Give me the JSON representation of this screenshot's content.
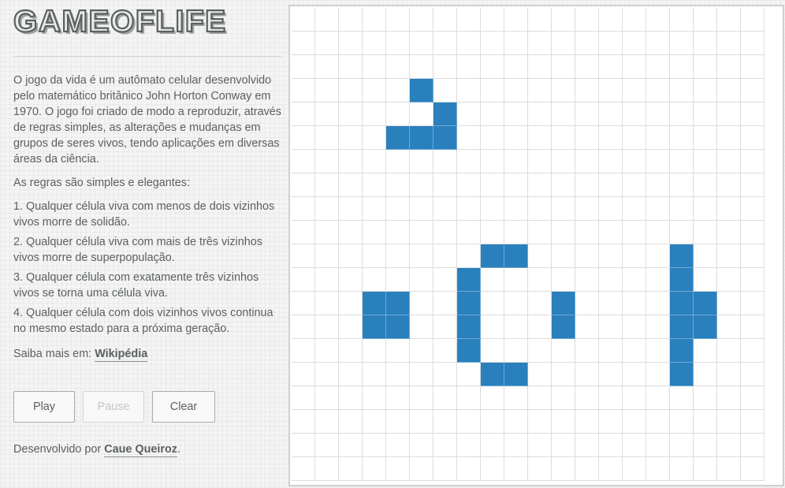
{
  "title": "GAMEOFLIFE",
  "intro": "O jogo da vida é um autômato celular desenvolvido pelo matemático britânico John Horton Conway em 1970. O jogo foi criado de modo a reproduzir, através de regras simples, as alterações e mudanças em grupos de seres vivos, tendo aplicações em diversas áreas da ciência.",
  "rules_heading": "As regras são simples e elegantes:",
  "rules": [
    "1. Qualquer célula viva com menos de dois vizinhos vivos morre de solidão.",
    "2. Qualquer célula viva com mais de três vizinhos vivos morre de superpopulação.",
    "3. Qualquer célula com exatamente três vizinhos vivos se torna uma célula viva.",
    "4. Qualquer célula com dois vizinhos vivos continua no mesmo estado para a próxima geração."
  ],
  "learn_more": {
    "prefix": "Saiba mais em:",
    "link": "Wikipédia"
  },
  "buttons": {
    "play": "Play",
    "pause": "Pause",
    "clear": "Clear",
    "pause_disabled": true
  },
  "footer": {
    "prefix": "Desenvolvido por",
    "author": "Caue Queiroz",
    "suffix": "."
  },
  "colors": {
    "alive": "#2a7fbd",
    "grid_line": "#dcdcdc",
    "text": "#5b6061"
  },
  "board": {
    "rows": 20,
    "cols": 20,
    "alive": [
      [
        3,
        5
      ],
      [
        4,
        6
      ],
      [
        5,
        4
      ],
      [
        5,
        5
      ],
      [
        5,
        6
      ],
      [
        10,
        8
      ],
      [
        10,
        9
      ],
      [
        11,
        7
      ],
      [
        12,
        7
      ],
      [
        13,
        7
      ],
      [
        14,
        7
      ],
      [
        15,
        8
      ],
      [
        15,
        9
      ],
      [
        12,
        3
      ],
      [
        12,
        4
      ],
      [
        13,
        3
      ],
      [
        13,
        4
      ],
      [
        12,
        11
      ],
      [
        13,
        11
      ],
      [
        10,
        16
      ],
      [
        11,
        16
      ],
      [
        12,
        16
      ],
      [
        12,
        17
      ],
      [
        13,
        16
      ],
      [
        13,
        17
      ],
      [
        14,
        16
      ],
      [
        15,
        16
      ]
    ]
  }
}
